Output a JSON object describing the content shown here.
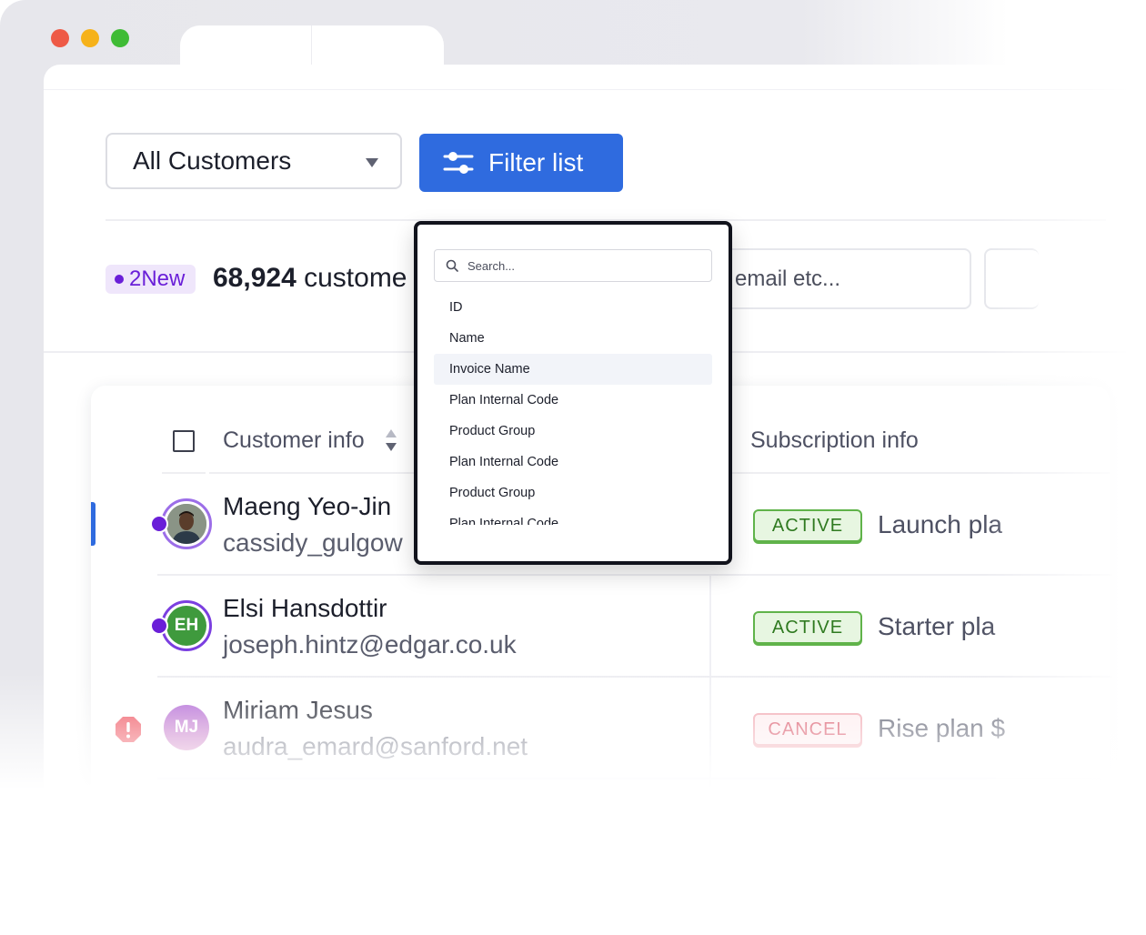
{
  "window": {
    "dots": [
      "#ee5a46",
      "#f6b21a",
      "#3fbb35"
    ]
  },
  "toolbar": {
    "select_value": "All Customers",
    "filter_label": "Filter list"
  },
  "summary": {
    "new_badge": "2New",
    "count": "68,924",
    "count_suffix": "custome",
    "search_placeholder": "email etc..."
  },
  "table": {
    "headers": {
      "customer": "Customer info",
      "subscription": "Subscription info"
    },
    "rows": [
      {
        "name": "Maeng Yeo-Jin",
        "email": "cassidy_gulgow",
        "status": "ACTIVE",
        "plan": "Launch pla",
        "avatar": "photo",
        "initials": ""
      },
      {
        "name": "Elsi Hansdottir",
        "email": "joseph.hintz@edgar.co.uk",
        "status": "ACTIVE",
        "plan": "Starter pla",
        "avatar": "initials",
        "initials": "EH"
      },
      {
        "name": "Miriam Jesus",
        "email": "audra_emard@sanford.net",
        "status": "CANCEL",
        "plan": "Rise plan $",
        "avatar": "initials",
        "initials": "MJ"
      }
    ]
  },
  "dropdown": {
    "search_placeholder": "Search...",
    "items": [
      "ID",
      "Name",
      "Invoice Name",
      "Plan Internal Code",
      "Product Group",
      "Plan Internal Code",
      "Product Group",
      "Plan Internal Code"
    ],
    "highlighted_index": 2
  },
  "colors": {
    "accent": "#2f6bdf",
    "new": "#6a1fd8",
    "active": "#60b34a",
    "cancel": "#d6475b"
  }
}
